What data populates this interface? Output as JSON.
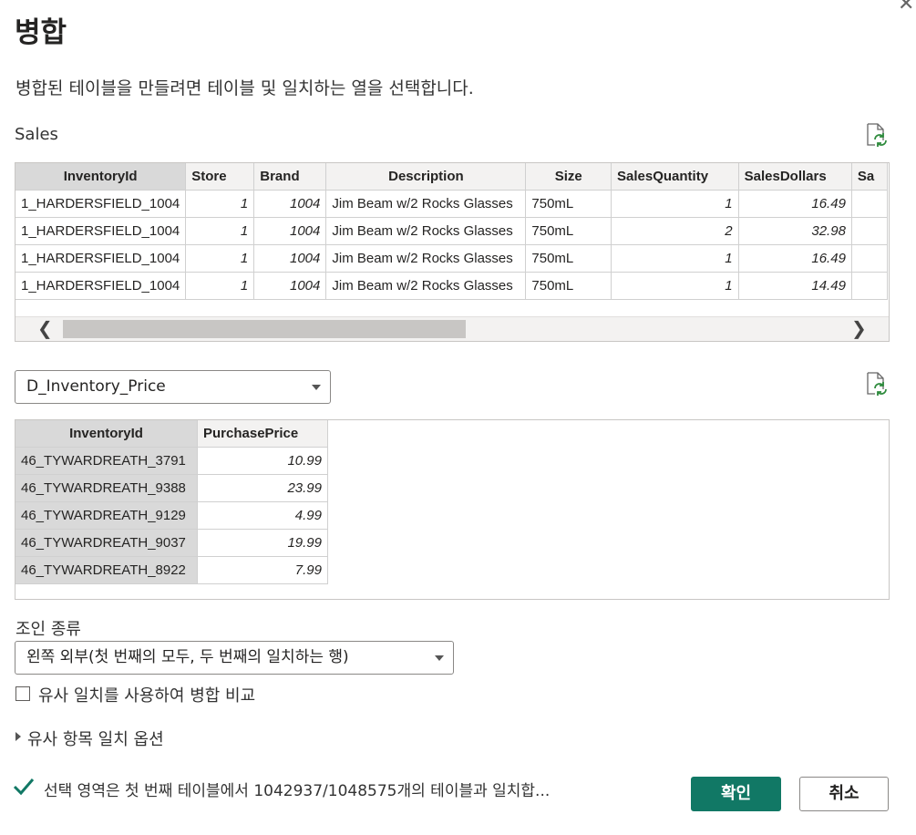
{
  "dialog": {
    "title": "병합",
    "close_glyph": "✕",
    "subtitle": "병합된 테이블을 만들려면 테이블 및 일치하는 열을 선택합니다."
  },
  "table1": {
    "name": "Sales",
    "columns": [
      "InventoryId",
      "Store",
      "Brand",
      "Description",
      "Size",
      "SalesQuantity",
      "SalesDollars",
      "Sa"
    ],
    "rows": [
      [
        "1_HARDERSFIELD_1004",
        "1",
        "1004",
        "Jim Beam w/2 Rocks Glasses",
        "750mL",
        "1",
        "16.49"
      ],
      [
        "1_HARDERSFIELD_1004",
        "1",
        "1004",
        "Jim Beam w/2 Rocks Glasses",
        "750mL",
        "2",
        "32.98"
      ],
      [
        "1_HARDERSFIELD_1004",
        "1",
        "1004",
        "Jim Beam w/2 Rocks Glasses",
        "750mL",
        "1",
        "16.49"
      ],
      [
        "1_HARDERSFIELD_1004",
        "1",
        "1004",
        "Jim Beam w/2 Rocks Glasses",
        "750mL",
        "1",
        "14.49"
      ]
    ],
    "scroll_left": "❮",
    "scroll_right": "❯"
  },
  "table2": {
    "selected": "D_Inventory_Price",
    "columns": [
      "InventoryId",
      "PurchasePrice"
    ],
    "rows": [
      [
        "46_TYWARDREATH_3791",
        "10.99"
      ],
      [
        "46_TYWARDREATH_9388",
        "23.99"
      ],
      [
        "46_TYWARDREATH_9129",
        "4.99"
      ],
      [
        "46_TYWARDREATH_9037",
        "19.99"
      ],
      [
        "46_TYWARDREATH_8922",
        "7.99"
      ]
    ]
  },
  "join": {
    "label": "조인 종류",
    "selected": "왼쪽 외부(첫 번째의 모두, 두 번째의 일치하는 행)"
  },
  "fuzzy": {
    "checkbox_label": "유사 일치를 사용하여 병합 비교",
    "options_label": "유사 항목 일치 옵션"
  },
  "status": {
    "text": "선택 영역은 첫 번째 테이블에서 1042937/1048575개의 테이블과 일치합..."
  },
  "buttons": {
    "ok": "확인",
    "cancel": "취소"
  },
  "colors": {
    "primary": "#117865",
    "check": "#117865",
    "refresh_green": "#2e8b3d"
  }
}
